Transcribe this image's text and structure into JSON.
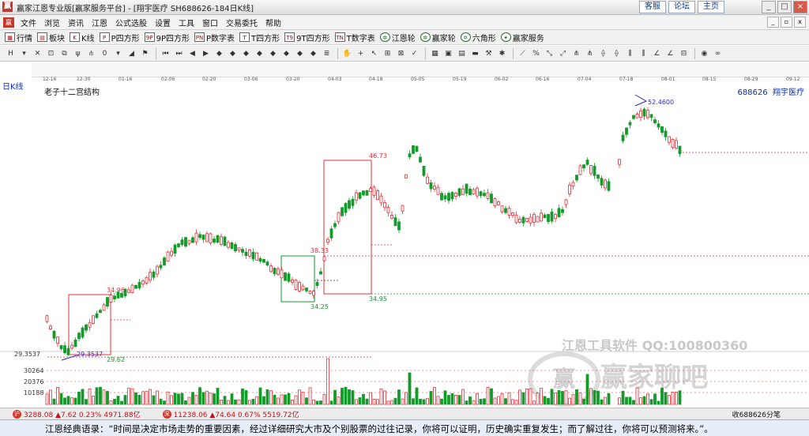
{
  "window": {
    "title": "赢家江恩专业版[赢家服务平台] - [翔宇医疗   SH688626-184日K线]",
    "links": [
      "客服",
      "论坛",
      "主页"
    ]
  },
  "menu": [
    "文件",
    "浏览",
    "资讯",
    "江恩",
    "公式选股",
    "设置",
    "工具",
    "窗口",
    "交易委托",
    "帮助"
  ],
  "toolbar1": [
    {
      "label": "行情",
      "icon": "grid-icon"
    },
    {
      "label": "板块",
      "icon": "blocks-icon"
    },
    {
      "label": "K线",
      "icon": "candlestick-icon"
    },
    {
      "label": "P四方形",
      "icon": "p-square-icon"
    },
    {
      "label": "9P四方形",
      "icon": "9p-square-icon"
    },
    {
      "label": "P数字表",
      "icon": "p-table-icon"
    },
    {
      "label": "T四方形",
      "icon": "t-square-icon"
    },
    {
      "label": "9T四方形",
      "icon": "9t-square-icon"
    },
    {
      "label": "T数字表",
      "icon": "t-table-icon"
    },
    {
      "label": "江恩轮",
      "icon": "gann-wheel-icon"
    },
    {
      "label": "赢家轮",
      "icon": "winner-wheel-icon"
    },
    {
      "label": "六角形",
      "icon": "hexagon-icon"
    },
    {
      "label": "赢家服务",
      "icon": "service-icon"
    }
  ],
  "date_axis": [
    "12-16",
    "12-30",
    "01-16",
    "02-06",
    "02-20",
    "03-06",
    "03-20",
    "04-03",
    "04-18",
    "05-05",
    "05-19",
    "06-02",
    "06-16",
    "07-04",
    "07-18",
    "08-01",
    "08-15",
    "08-29",
    "09-12"
  ],
  "chart": {
    "period": "日K线",
    "overlay_name": "老子十二宫结构",
    "stock_code": "688626",
    "stock_name": "翔宇医疗",
    "left_level": "29.3537",
    "labels": {
      "low": "29.3537",
      "box1_top": "34.96",
      "box1_bottom": "29.62",
      "box2_top": "38.33",
      "box2_bottom": "34.25",
      "box3_top": "46.73",
      "box3_bottom": "34.95",
      "high": "52.4600"
    },
    "volume_ticks": [
      "30264",
      "20376",
      "10188"
    ]
  },
  "watermark": {
    "line1": "江恩工具软件  QQ:100800360",
    "line2": "赢家聊吧",
    "logo_text": "赢"
  },
  "status": {
    "index1": "3288.08 ▲7.62 0.23% 4971.88亿",
    "index2": "11238.06 ▲74.64 0.67% 5519.72亿",
    "right": "收688626分笔"
  },
  "quote": "江恩经典语录：“时间是决定市场走势的重要因素，经过详细研究大市及个别股票的过往记录，你将可以证明，历史确实重复发生；而了解过往，你将可以预测将来。”。",
  "colors": {
    "up": "#e0303a",
    "down": "#139a2a",
    "annotation": "#2a2ac8"
  }
}
